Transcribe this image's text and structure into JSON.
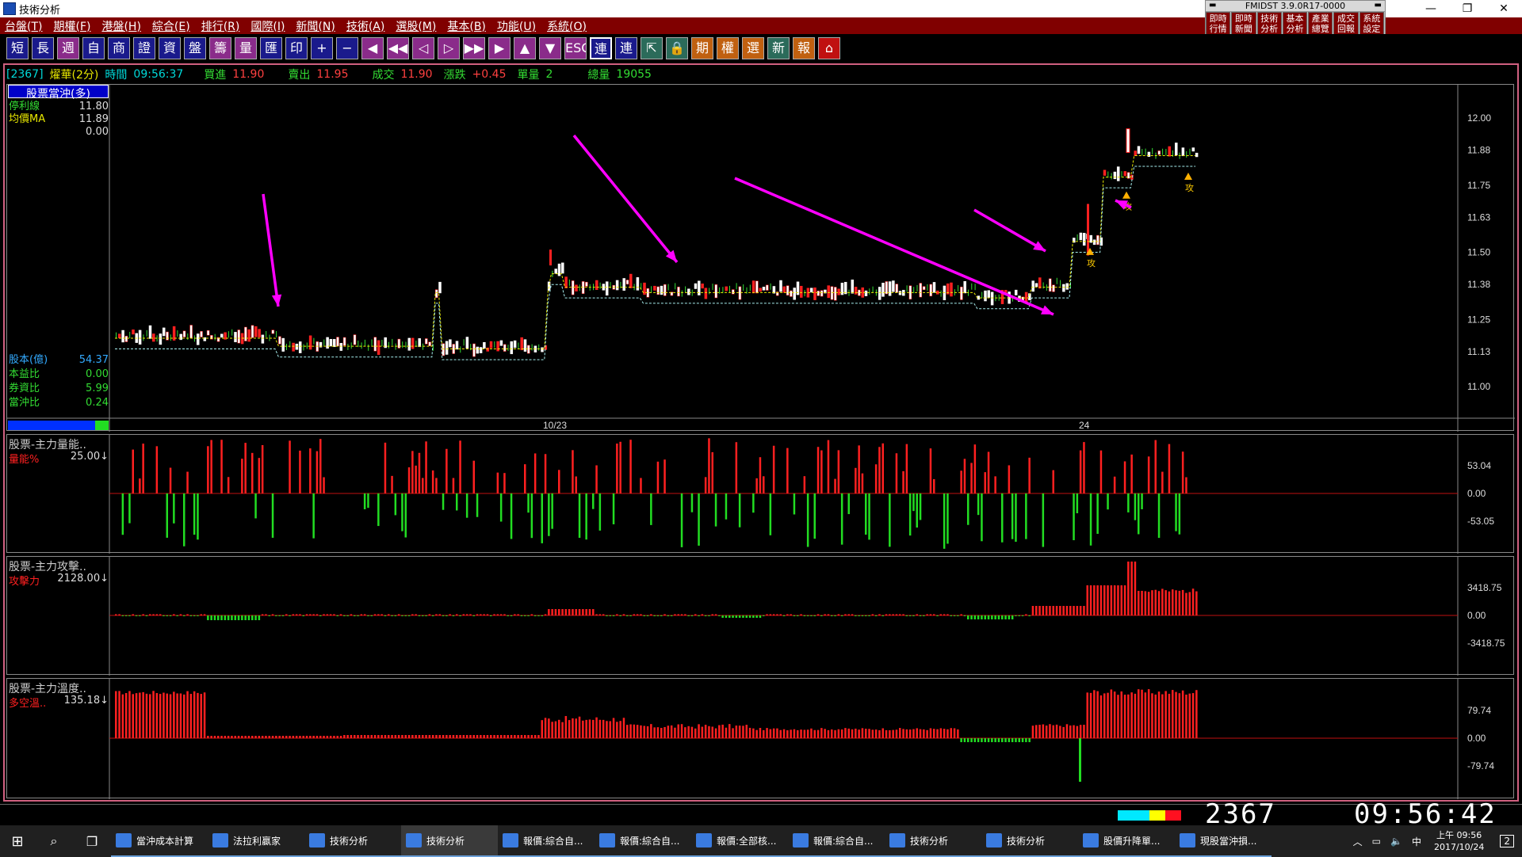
{
  "window": {
    "title": "技術分析"
  },
  "menu": [
    "台盤(T)",
    "期權(F)",
    "港盤(H)",
    "綜合(E)",
    "排行(R)",
    "國際(I)",
    "新聞(N)",
    "技術(A)",
    "選股(M)",
    "基本(B)",
    "功能(U)",
    "系統(O)"
  ],
  "fmidst": {
    "version": "FMIDST 3.9.0R17-0000",
    "buttons": [
      "即時\n行情",
      "即時\n新聞",
      "技術\n分析",
      "基本\n分析",
      "產業\n總覽",
      "成交\n回報",
      "系統\n設定"
    ]
  },
  "toolbar": [
    "短",
    "長",
    "週",
    "自",
    "商",
    "證",
    "資",
    "盤",
    "籌",
    "量",
    "匯",
    "印",
    "+",
    "−",
    "◀",
    "◀◀",
    "◁",
    "▷",
    "▶▶",
    "▶",
    "▲",
    "▼",
    "ESC",
    "連",
    "連",
    "⇱",
    "🔒",
    "期",
    "權",
    "選",
    "新",
    "報",
    "⌂"
  ],
  "quote": {
    "code": "[2367]",
    "name": "燿華(2分)",
    "time_label": "時間",
    "time": "09:56:37",
    "bid_label": "買進",
    "bid": "11.90",
    "ask_label": "賣出",
    "ask": "11.95",
    "last_label": "成交",
    "last": "11.90",
    "chg_label": "漲跌",
    "chg": "+0.45",
    "vol_label": "單量",
    "vol": "2",
    "tvol_label": "總量",
    "tvol": "19055"
  },
  "main_panel": {
    "title": "股票當沖(多)",
    "legend": [
      {
        "label": "停利線",
        "value": "11.80"
      },
      {
        "label": "均價MA",
        "value": "11.89"
      },
      {
        "label": "",
        "value": "0.00"
      }
    ],
    "fundamentals": [
      {
        "label": "股本(億)",
        "value": "54.37"
      },
      {
        "label": "本益比",
        "value": "0.00"
      },
      {
        "label": "券資比",
        "value": "5.99"
      },
      {
        "label": "當沖比",
        "value": "0.24"
      }
    ],
    "y_ticks": [
      "12.00",
      "11.88",
      "11.75",
      "11.63",
      "11.50",
      "11.38",
      "11.25",
      "11.13",
      "11.00"
    ],
    "x_labels": [
      "10/23",
      "24"
    ],
    "signal_label": "攻"
  },
  "volume_panel": {
    "title": "股票-主力量能..",
    "indicator": "量能%",
    "value": "25.00↓",
    "y_ticks": [
      "53.04",
      "0.00",
      "-53.05"
    ]
  },
  "attack_panel": {
    "title": "股票-主力攻擊..",
    "indicator": "攻擊力",
    "value": "2128.00↓",
    "y_ticks": [
      "3418.75",
      "0.00",
      "-3418.75"
    ]
  },
  "temp_panel": {
    "title": "股票-主力溫度..",
    "indicator": "多空溫..",
    "value": "135.18↓",
    "y_ticks": [
      "79.74",
      "0.00",
      "-79.74"
    ]
  },
  "status": {
    "code": "2367",
    "time": "09:56:42"
  },
  "taskbar": {
    "tasks": [
      "當沖成本計算",
      "法拉利贏家",
      "技術分析",
      "技術分析",
      "報價:綜合自...",
      "報價:綜合自...",
      "報價:全部核...",
      "報價:綜合自...",
      "技術分析",
      "技術分析",
      "股價升降單...",
      "現股當沖損..."
    ],
    "clock_time": "上午 09:56",
    "clock_date": "2017/10/24",
    "ime": "中",
    "notify": "2"
  },
  "colors": {
    "up": "#ff2020",
    "down": "#22dd22",
    "ma": "#e8e800",
    "stop": "#a8f0f0",
    "arrow": "#ff00ff"
  }
}
